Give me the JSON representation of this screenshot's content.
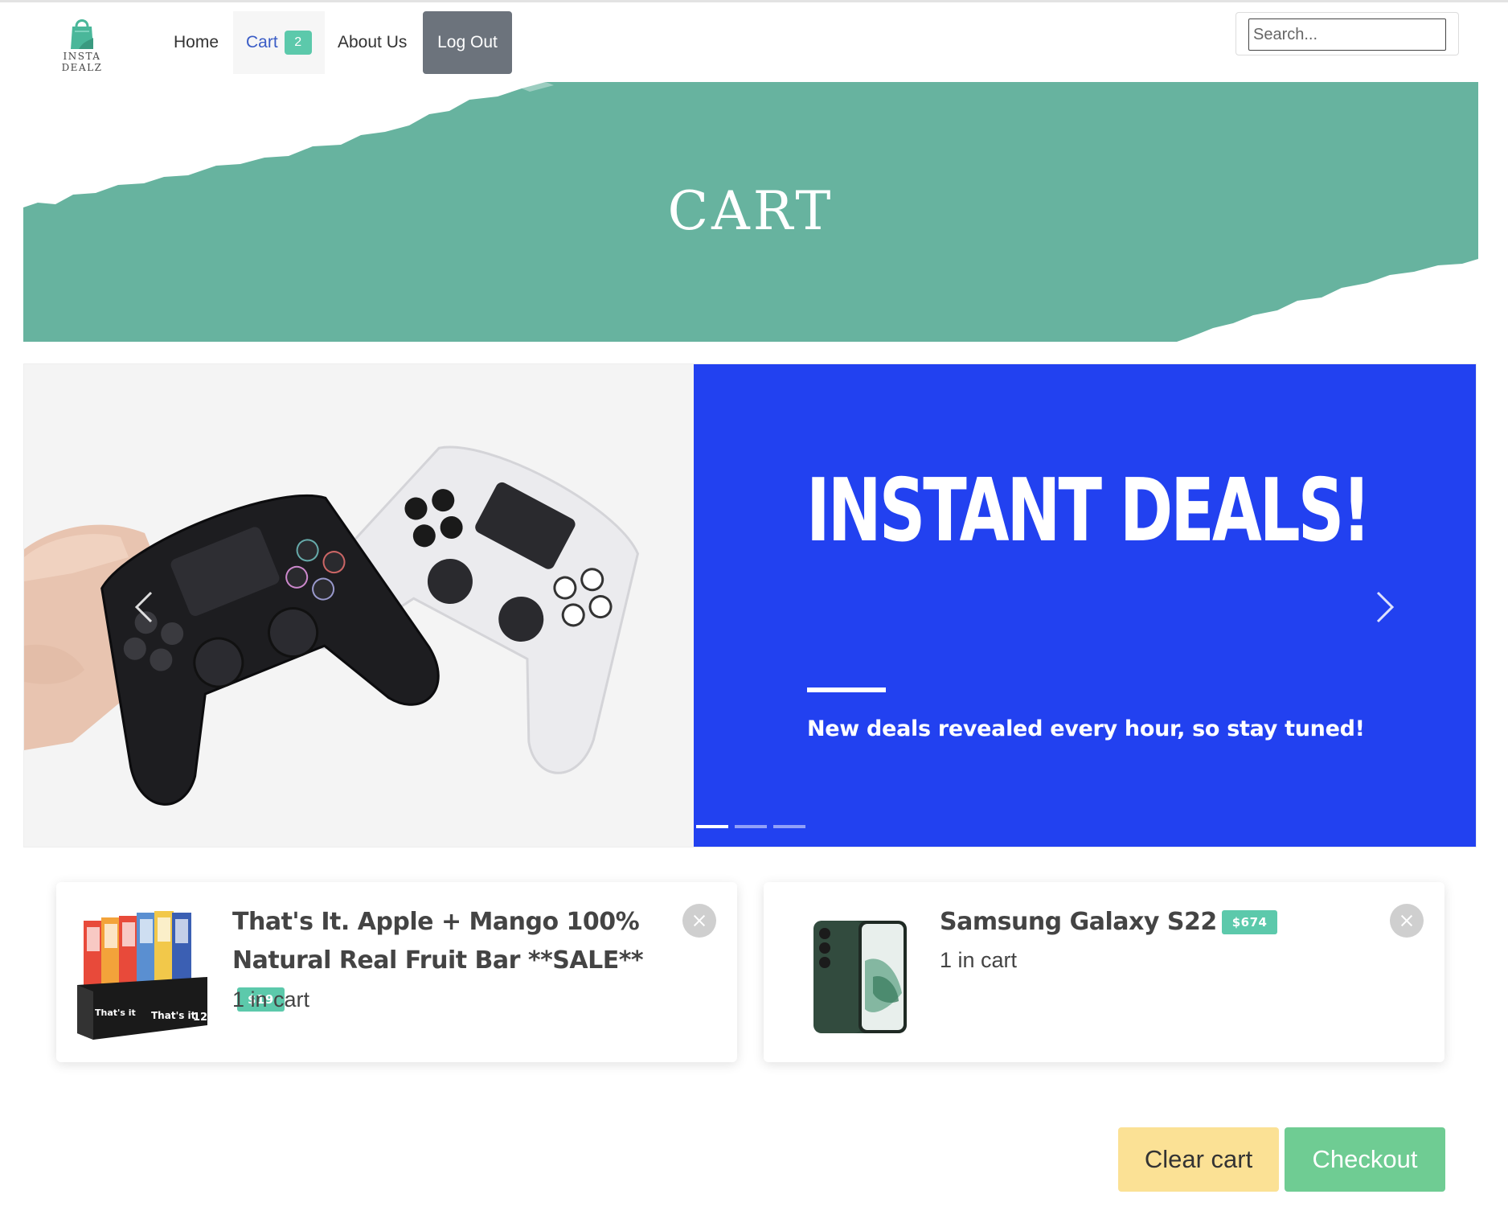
{
  "brand": {
    "name": "INSTA DEALZ",
    "color": "#4ab79a"
  },
  "nav": {
    "home": "Home",
    "cart": "Cart",
    "cart_count": "2",
    "about": "About Us",
    "logout": "Log Out"
  },
  "search": {
    "placeholder": "Search...",
    "value": ""
  },
  "banner": {
    "title": "CART",
    "color": "#67b39f"
  },
  "carousel": {
    "headline": "INSTANT DEALS!",
    "subtext": "New deals revealed every hour, so stay tuned!",
    "background": "#2241f0",
    "slide_count": 3,
    "active_slide": 1
  },
  "cart_items": [
    {
      "title": "That's It. Apple + Mango 100% Natural Real Fruit Bar **SALE**",
      "price": "$19",
      "quantity": "1 in cart",
      "image_icon": "fruit-bar-box-icon",
      "box_labels": [
        "That's it",
        "That's it",
        "12"
      ]
    },
    {
      "title": "Samsung Galaxy S22",
      "price": "$674",
      "quantity": "1 in cart",
      "image_icon": "smartphone-icon"
    }
  ],
  "actions": {
    "clear": "Clear cart",
    "checkout": "Checkout"
  },
  "colors": {
    "accent": "#5cc9ab",
    "clear_button": "#fbe195",
    "checkout_button": "#6fcc93",
    "logout_button": "#6c737c"
  }
}
